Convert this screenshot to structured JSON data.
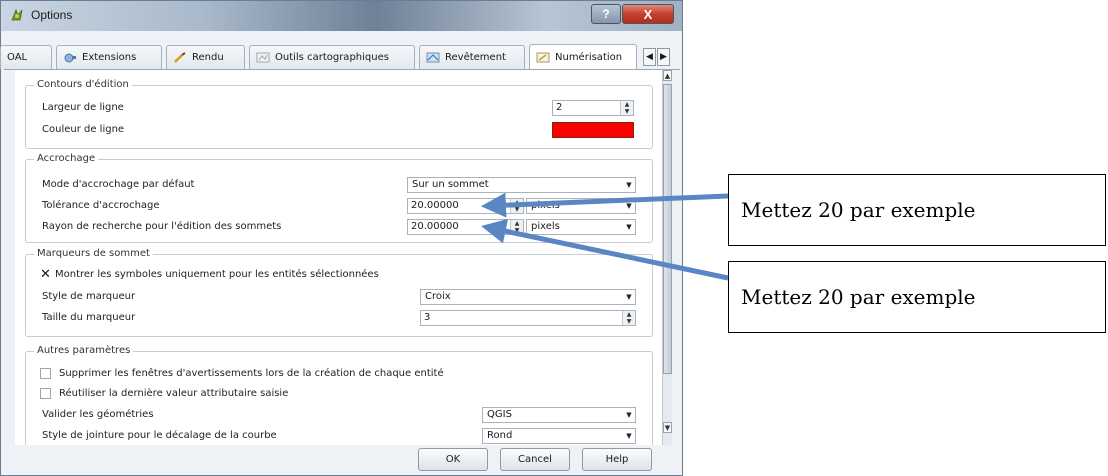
{
  "window": {
    "title": "Options",
    "help_glyph": "?",
    "close_glyph": "X"
  },
  "tabs": [
    {
      "label": "OAL",
      "icon": "none"
    },
    {
      "label": "Extensions",
      "icon": "plugin-icon"
    },
    {
      "label": "Rendu",
      "icon": "brush-icon"
    },
    {
      "label": "Outils cartographiques",
      "icon": "map-tools-icon"
    },
    {
      "label": "Revêtement",
      "icon": "overlay-icon"
    },
    {
      "label": "Numérisation",
      "icon": "digitizing-icon"
    }
  ],
  "tab_nav": {
    "left": "◀",
    "right": "▶"
  },
  "groups": {
    "contours": {
      "title": "Contours d'édition",
      "line_width_label": "Largeur de ligne",
      "line_width_value": "2",
      "line_color_label": "Couleur de ligne",
      "line_color": "#ff0000"
    },
    "accrochage": {
      "title": "Accrochage",
      "mode_label": "Mode d'accrochage par défaut",
      "mode_value": "Sur un sommet",
      "tolerance_label": "Tolérance d'accrochage",
      "tolerance_value": "20.00000",
      "tolerance_unit": "pixels",
      "radius_label": "Rayon de recherche pour l'édition des sommets",
      "radius_value": "20.00000",
      "radius_unit": "pixels"
    },
    "marqueurs": {
      "title": "Marqueurs de sommet",
      "show_selected_label": "Montrer les symboles uniquement pour les entités sélectionnées",
      "show_selected_checked": true,
      "style_label": "Style de marqueur",
      "style_value": "Croix",
      "size_label": "Taille du marqueur",
      "size_value": "3"
    },
    "autres": {
      "title": "Autres paramètres",
      "suppress_label": "Supprimer les fenêtres d'avertissements lors de la création de chaque entité",
      "suppress_checked": false,
      "reuse_label": "Réutiliser la dernière valeur attributaire saisie",
      "reuse_checked": false,
      "validate_label": "Valider les géométries",
      "validate_value": "QGIS",
      "join_label": "Style de jointure pour le décalage de la courbe",
      "join_value": "Rond"
    }
  },
  "buttons": {
    "ok": "OK",
    "cancel": "Cancel",
    "help": "Help"
  },
  "callouts": [
    "Mettez 20 par exemple",
    "Mettez 20 par exemple"
  ],
  "colors": {
    "arrow": "#5b86c4",
    "accent_red": "#ff0000"
  }
}
